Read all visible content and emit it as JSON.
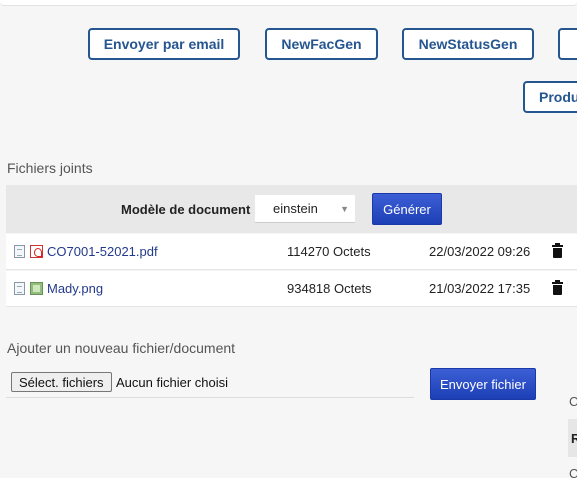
{
  "toolbar": {
    "buttons": [
      {
        "label": "Envoyer par email"
      },
      {
        "label": "NewFacGen"
      },
      {
        "label": "NewStatusGen"
      },
      {
        "label": ""
      },
      {
        "label": "Produ"
      }
    ]
  },
  "attachments": {
    "title": "Fichiers joints",
    "generate": {
      "label": "Modèle de document",
      "selected_model": "einstein",
      "button": "Générer"
    },
    "files": [
      {
        "name": "CO7001-52021.pdf",
        "size": "114270 Octets",
        "date": "22/03/2022 09:26",
        "type_icon": "pdf-icon"
      },
      {
        "name": "Mady.png",
        "size": "934818 Octets",
        "date": "21/03/2022 17:35",
        "type_icon": "image-icon"
      }
    ]
  },
  "upload": {
    "title": "Ajouter un nouveau fichier/document",
    "choose_button": "Sélect. fichiers",
    "status": "Aucun fichier choisi",
    "send_button": "Envoyer fichier"
  },
  "edge_fragments": [
    "C",
    "R",
    "C"
  ],
  "colors": {
    "accent": "#25568f",
    "primary_button": "#2a4cc4",
    "link": "#233a8c"
  }
}
